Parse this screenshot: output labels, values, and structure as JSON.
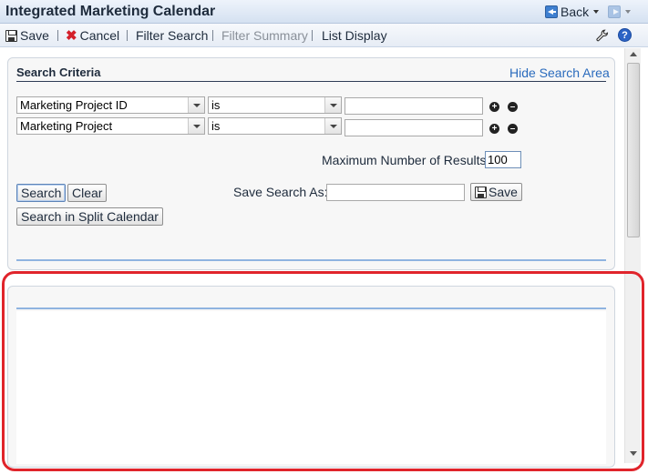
{
  "window": {
    "title": "Integrated Marketing Calendar",
    "back_label": "Back"
  },
  "toolbar": {
    "save": "Save",
    "cancel": "Cancel",
    "filter_search": "Filter Search",
    "filter_summary": "Filter Summary",
    "list_display": "List Display"
  },
  "search": {
    "title": "Search Criteria",
    "hide_link": "Hide Search Area",
    "rows": [
      {
        "field": "Marketing Project ID",
        "operator": "is",
        "value": ""
      },
      {
        "field": "Marketing Project",
        "operator": "is",
        "value": ""
      }
    ],
    "max_results_label": "Maximum Number of Results:",
    "max_results_value": "100",
    "search_button": "Search",
    "clear_button": "Clear",
    "save_search_label": "Save Search As:",
    "save_search_value": "",
    "save_button": "Save",
    "split_calendar_button": "Search in Split Calendar"
  },
  "icons": {
    "add": "plus-circle-icon",
    "remove": "minus-circle-icon",
    "settings": "wrench-icon",
    "help": "help-icon"
  },
  "colors": {
    "accent": "#2a6bbd",
    "highlight": "#e0242b",
    "rule": "#8fb4e0"
  }
}
